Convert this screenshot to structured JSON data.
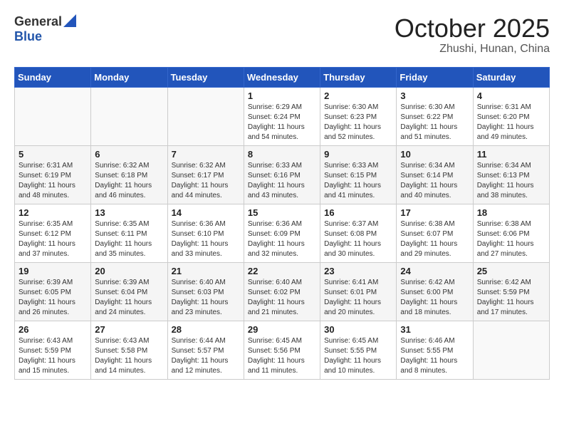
{
  "header": {
    "logo_general": "General",
    "logo_blue": "Blue",
    "month": "October 2025",
    "location": "Zhushi, Hunan, China"
  },
  "weekdays": [
    "Sunday",
    "Monday",
    "Tuesday",
    "Wednesday",
    "Thursday",
    "Friday",
    "Saturday"
  ],
  "weeks": [
    [
      {
        "day": "",
        "info": ""
      },
      {
        "day": "",
        "info": ""
      },
      {
        "day": "",
        "info": ""
      },
      {
        "day": "1",
        "info": "Sunrise: 6:29 AM\nSunset: 6:24 PM\nDaylight: 11 hours\nand 54 minutes."
      },
      {
        "day": "2",
        "info": "Sunrise: 6:30 AM\nSunset: 6:23 PM\nDaylight: 11 hours\nand 52 minutes."
      },
      {
        "day": "3",
        "info": "Sunrise: 6:30 AM\nSunset: 6:22 PM\nDaylight: 11 hours\nand 51 minutes."
      },
      {
        "day": "4",
        "info": "Sunrise: 6:31 AM\nSunset: 6:20 PM\nDaylight: 11 hours\nand 49 minutes."
      }
    ],
    [
      {
        "day": "5",
        "info": "Sunrise: 6:31 AM\nSunset: 6:19 PM\nDaylight: 11 hours\nand 48 minutes."
      },
      {
        "day": "6",
        "info": "Sunrise: 6:32 AM\nSunset: 6:18 PM\nDaylight: 11 hours\nand 46 minutes."
      },
      {
        "day": "7",
        "info": "Sunrise: 6:32 AM\nSunset: 6:17 PM\nDaylight: 11 hours\nand 44 minutes."
      },
      {
        "day": "8",
        "info": "Sunrise: 6:33 AM\nSunset: 6:16 PM\nDaylight: 11 hours\nand 43 minutes."
      },
      {
        "day": "9",
        "info": "Sunrise: 6:33 AM\nSunset: 6:15 PM\nDaylight: 11 hours\nand 41 minutes."
      },
      {
        "day": "10",
        "info": "Sunrise: 6:34 AM\nSunset: 6:14 PM\nDaylight: 11 hours\nand 40 minutes."
      },
      {
        "day": "11",
        "info": "Sunrise: 6:34 AM\nSunset: 6:13 PM\nDaylight: 11 hours\nand 38 minutes."
      }
    ],
    [
      {
        "day": "12",
        "info": "Sunrise: 6:35 AM\nSunset: 6:12 PM\nDaylight: 11 hours\nand 37 minutes."
      },
      {
        "day": "13",
        "info": "Sunrise: 6:35 AM\nSunset: 6:11 PM\nDaylight: 11 hours\nand 35 minutes."
      },
      {
        "day": "14",
        "info": "Sunrise: 6:36 AM\nSunset: 6:10 PM\nDaylight: 11 hours\nand 33 minutes."
      },
      {
        "day": "15",
        "info": "Sunrise: 6:36 AM\nSunset: 6:09 PM\nDaylight: 11 hours\nand 32 minutes."
      },
      {
        "day": "16",
        "info": "Sunrise: 6:37 AM\nSunset: 6:08 PM\nDaylight: 11 hours\nand 30 minutes."
      },
      {
        "day": "17",
        "info": "Sunrise: 6:38 AM\nSunset: 6:07 PM\nDaylight: 11 hours\nand 29 minutes."
      },
      {
        "day": "18",
        "info": "Sunrise: 6:38 AM\nSunset: 6:06 PM\nDaylight: 11 hours\nand 27 minutes."
      }
    ],
    [
      {
        "day": "19",
        "info": "Sunrise: 6:39 AM\nSunset: 6:05 PM\nDaylight: 11 hours\nand 26 minutes."
      },
      {
        "day": "20",
        "info": "Sunrise: 6:39 AM\nSunset: 6:04 PM\nDaylight: 11 hours\nand 24 minutes."
      },
      {
        "day": "21",
        "info": "Sunrise: 6:40 AM\nSunset: 6:03 PM\nDaylight: 11 hours\nand 23 minutes."
      },
      {
        "day": "22",
        "info": "Sunrise: 6:40 AM\nSunset: 6:02 PM\nDaylight: 11 hours\nand 21 minutes."
      },
      {
        "day": "23",
        "info": "Sunrise: 6:41 AM\nSunset: 6:01 PM\nDaylight: 11 hours\nand 20 minutes."
      },
      {
        "day": "24",
        "info": "Sunrise: 6:42 AM\nSunset: 6:00 PM\nDaylight: 11 hours\nand 18 minutes."
      },
      {
        "day": "25",
        "info": "Sunrise: 6:42 AM\nSunset: 5:59 PM\nDaylight: 11 hours\nand 17 minutes."
      }
    ],
    [
      {
        "day": "26",
        "info": "Sunrise: 6:43 AM\nSunset: 5:59 PM\nDaylight: 11 hours\nand 15 minutes."
      },
      {
        "day": "27",
        "info": "Sunrise: 6:43 AM\nSunset: 5:58 PM\nDaylight: 11 hours\nand 14 minutes."
      },
      {
        "day": "28",
        "info": "Sunrise: 6:44 AM\nSunset: 5:57 PM\nDaylight: 11 hours\nand 12 minutes."
      },
      {
        "day": "29",
        "info": "Sunrise: 6:45 AM\nSunset: 5:56 PM\nDaylight: 11 hours\nand 11 minutes."
      },
      {
        "day": "30",
        "info": "Sunrise: 6:45 AM\nSunset: 5:55 PM\nDaylight: 11 hours\nand 10 minutes."
      },
      {
        "day": "31",
        "info": "Sunrise: 6:46 AM\nSunset: 5:55 PM\nDaylight: 11 hours\nand 8 minutes."
      },
      {
        "day": "",
        "info": ""
      }
    ]
  ]
}
